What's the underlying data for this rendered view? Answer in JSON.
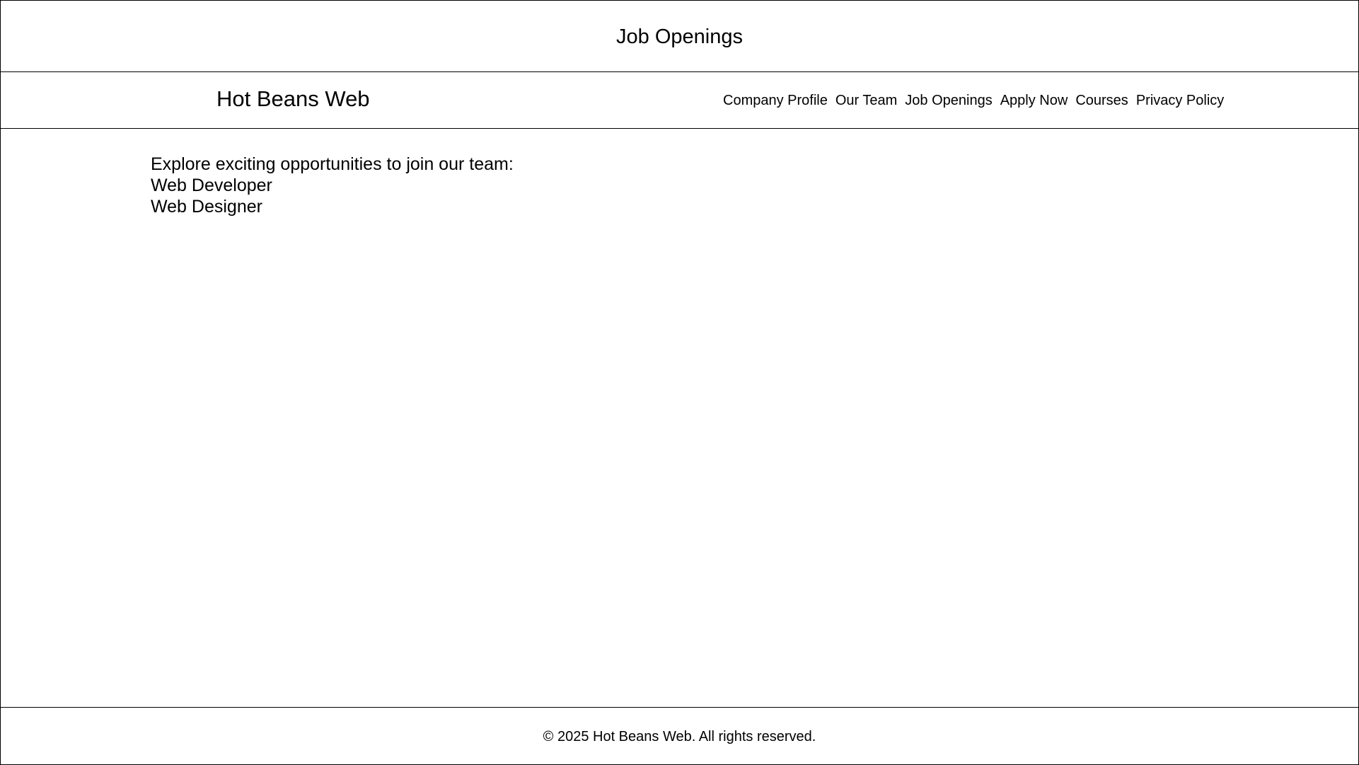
{
  "page": {
    "title": "Job Openings"
  },
  "header": {
    "brand": "Hot Beans Web",
    "nav": [
      {
        "label": "Company Profile"
      },
      {
        "label": "Our Team"
      },
      {
        "label": "Job Openings"
      },
      {
        "label": "Apply Now"
      },
      {
        "label": "Courses"
      },
      {
        "label": "Privacy Policy"
      }
    ]
  },
  "main": {
    "intro": "Explore exciting opportunities to join our team:",
    "jobs": [
      {
        "title": "Web Developer"
      },
      {
        "title": "Web Designer"
      }
    ]
  },
  "footer": {
    "copyright": "© 2025 Hot Beans Web. All rights reserved."
  }
}
